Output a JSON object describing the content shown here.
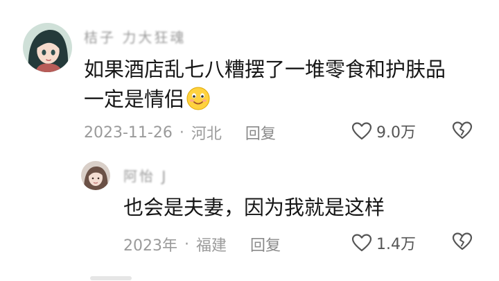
{
  "comment": {
    "username": "桔子 力大狂魂",
    "content_line1": "如果酒店乱七八糟摆了一堆零食和护肤品",
    "content_line2": "一定是情侣",
    "date": "2023-11-26",
    "separator": "·",
    "location": "河北",
    "reply_label": "回复",
    "like_count": "9.0万",
    "emoji": "smiling-face-emoji"
  },
  "reply": {
    "username": "阿怡 J",
    "content": "也会是夫妻，因为我就是这样",
    "date": "2023年",
    "separator": "·",
    "location": "福建",
    "reply_label": "回复",
    "like_count": "1.4万"
  },
  "icons": {
    "like": "heart-outline-icon",
    "dislike": "broken-heart-icon"
  }
}
